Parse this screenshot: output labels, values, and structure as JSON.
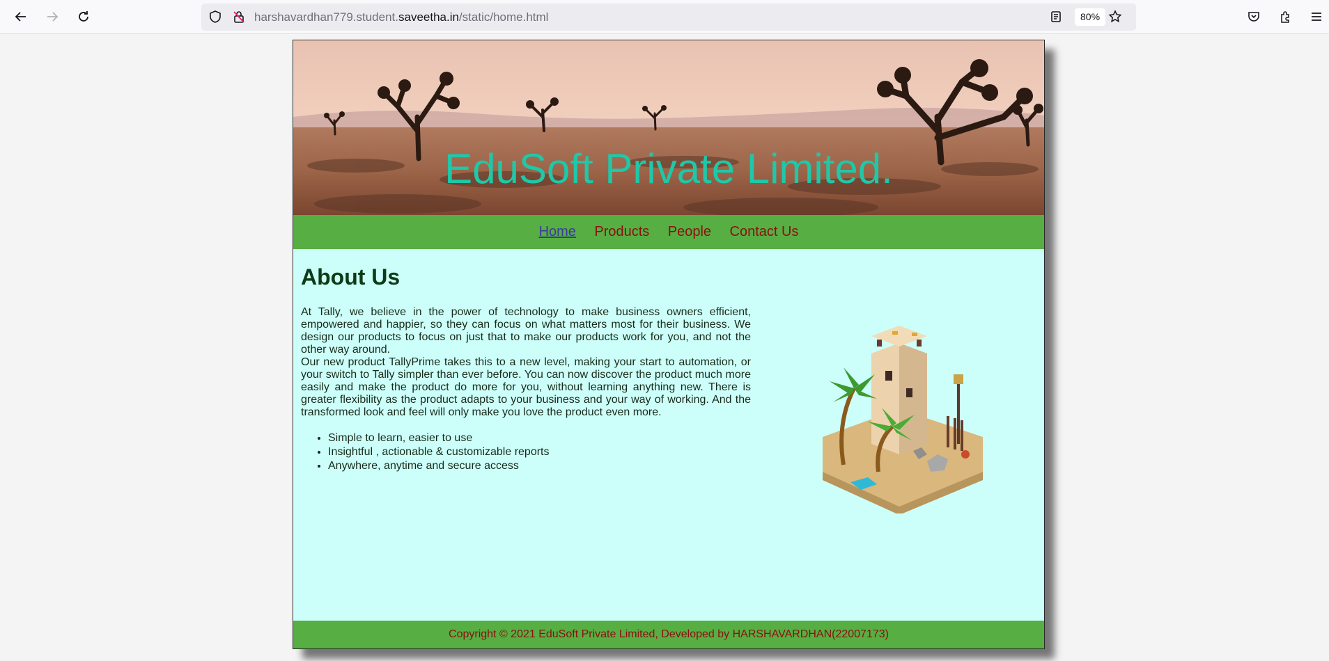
{
  "browser": {
    "url_prefix": "harshavardhan779.student.",
    "url_domain": "saveetha.in",
    "url_path": "/static/home.html",
    "zoom": "80%"
  },
  "site": {
    "title": "EduSoft Private Limited.",
    "nav": [
      "Home",
      "Products",
      "People",
      "Contact Us"
    ],
    "heading": "About Us",
    "para1": "At Tally, we believe in the power of technology to make business owners efficient, empowered and happier, so they can focus on what matters most for their business. We design our products to focus on just that to make our products work for you, and not the other way around.",
    "para2": "Our new product TallyPrime takes this to a new level, making your start to automation, or your switch to Tally simpler than ever before. You can now discover the product much more easily and make the product do more for you, without learning anything new. There is greater flexibility as the product adapts to your business and your way of working. And the transformed look and feel will only make you love the product even more.",
    "bullets": [
      "Simple to learn, easier to use",
      "Insightful , actionable & customizable reports",
      "Anywhere, anytime and secure access"
    ],
    "footer": "Copyright © 2021 EduSoft Private Limited, Developed by HARSHAVARDHAN(22007173)"
  },
  "colors": {
    "nav_bg": "#57ae43",
    "content_bg": "#ccfff9",
    "title_color": "#1ec8a8",
    "link_color": "#8b1010"
  }
}
